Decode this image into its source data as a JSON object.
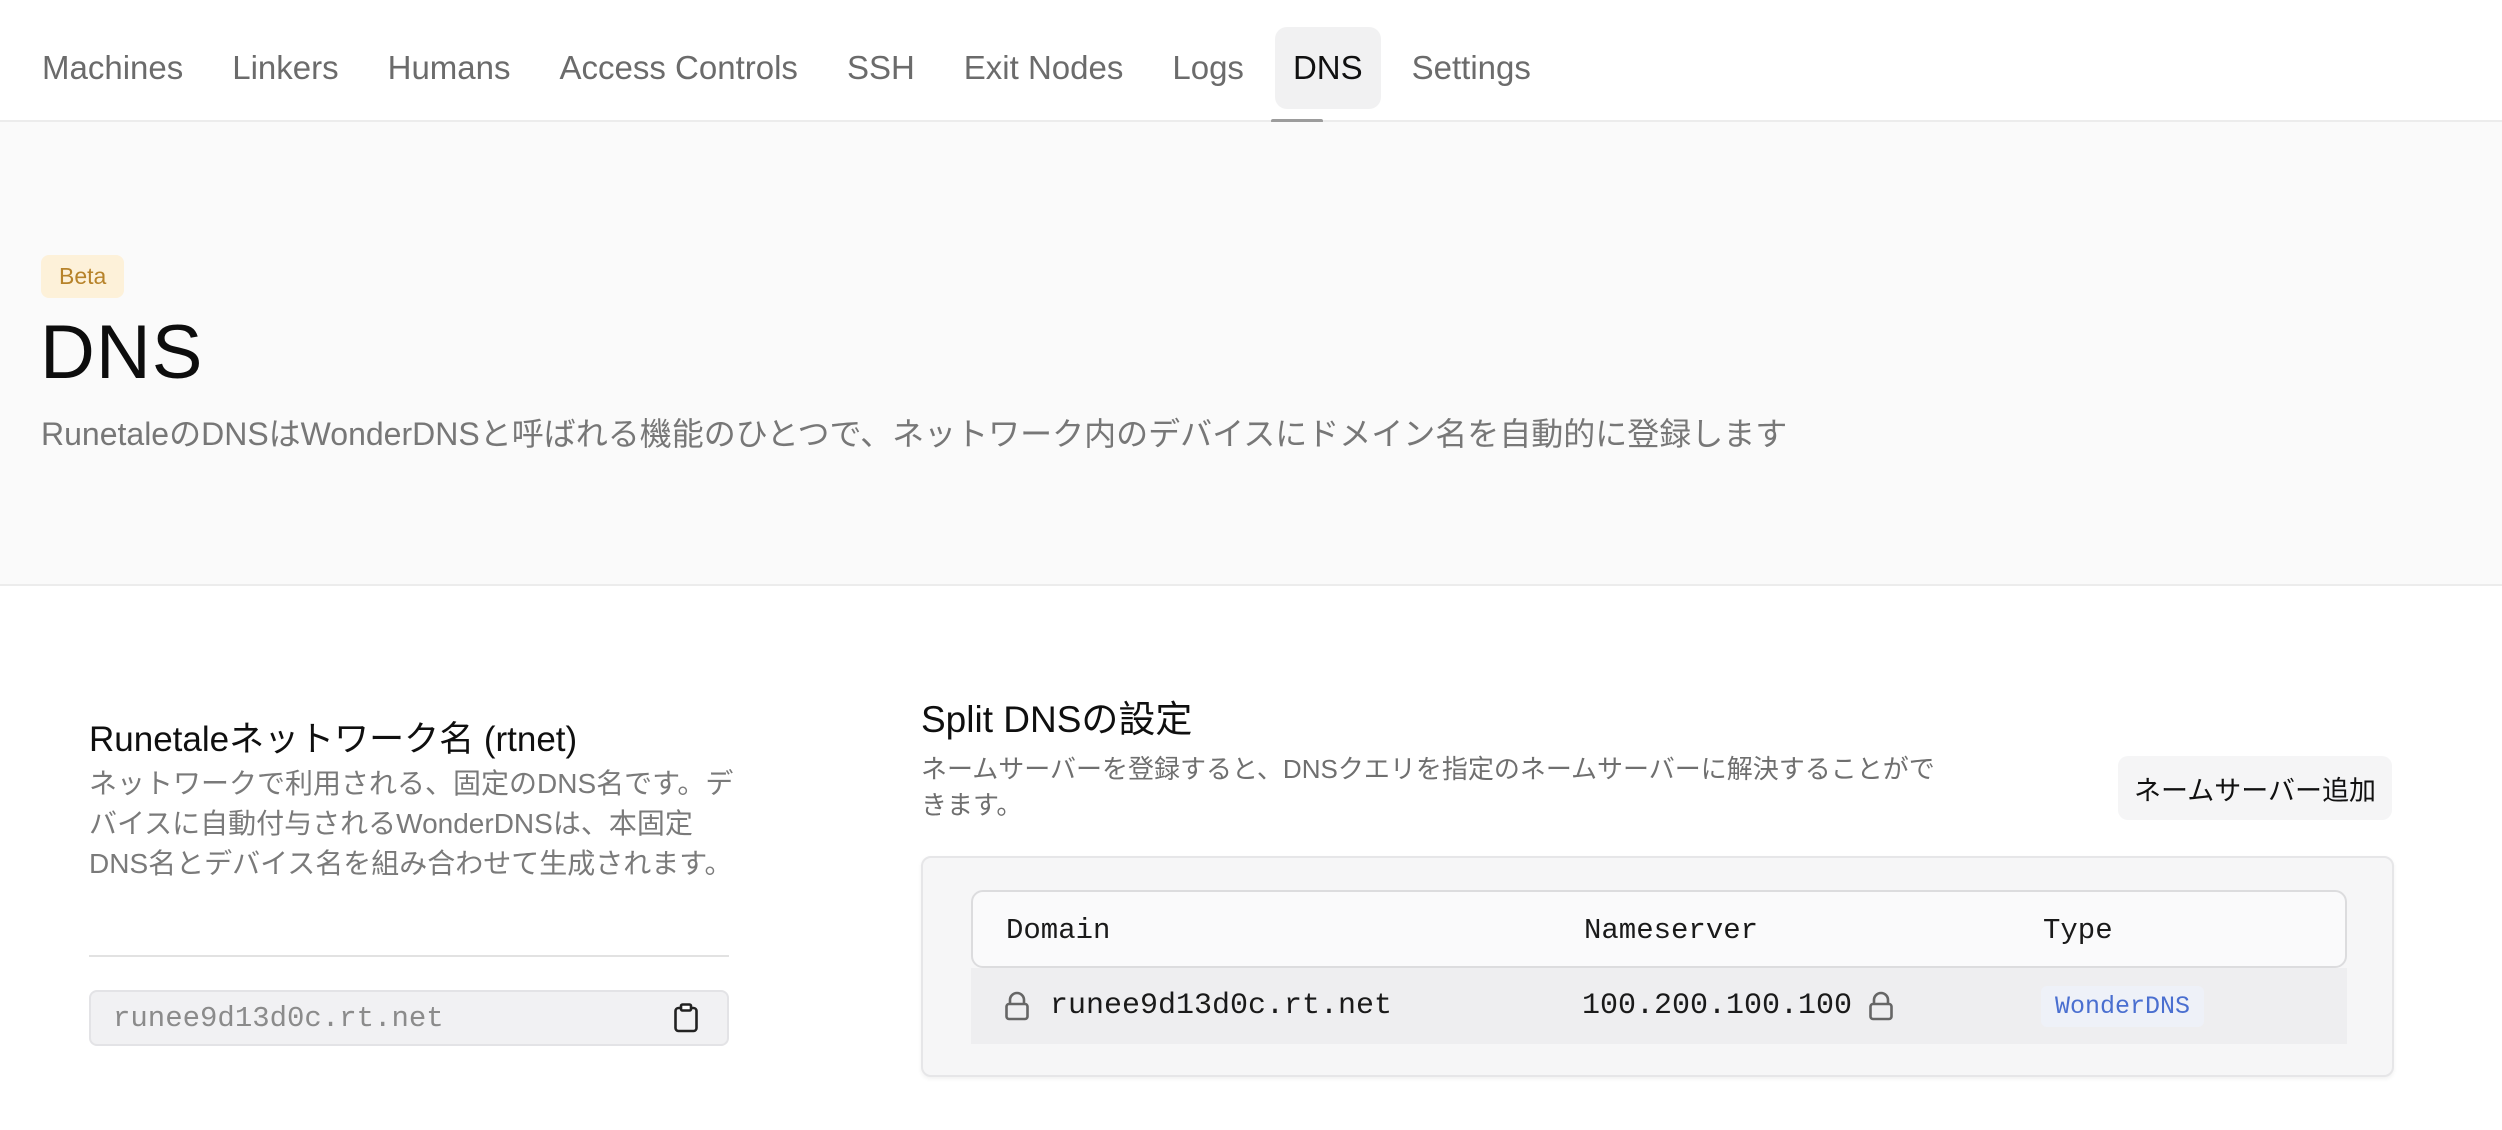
{
  "nav": {
    "tabs": [
      {
        "label": "Machines"
      },
      {
        "label": "Linkers"
      },
      {
        "label": "Humans"
      },
      {
        "label": "Access Controls"
      },
      {
        "label": "SSH"
      },
      {
        "label": "Exit Nodes"
      },
      {
        "label": "Logs"
      },
      {
        "label": "DNS",
        "active": true
      },
      {
        "label": "Settings"
      }
    ]
  },
  "hero": {
    "badge": "Beta",
    "title": "DNS",
    "description": "RunetaleのDNSはWonderDNSと呼ばれる機能のひとつで、ネットワーク内のデバイスにドメイン名を自動的に登録します"
  },
  "network": {
    "title": "Runetaleネットワーク名 (rtnet)",
    "description": "ネットワークで利用される、固定のDNS名です。デバイスに自動付与されるWonderDNSは、本固定DNS名とデバイス名を組み合わせて生成されます。",
    "value": "runee9d13d0c.rt.net",
    "copy_icon": "clipboard-icon"
  },
  "split_dns": {
    "title": "Split DNSの設定",
    "description": "ネームサーバーを登録すると、DNSクエリを指定のネームサーバーに解決することができます。",
    "add_button": "ネームサーバー追加",
    "columns": {
      "domain": "Domain",
      "nameserver": "Nameserver",
      "type": "Type"
    },
    "rows": [
      {
        "domain": "runee9d13d0c.rt.net",
        "nameserver": "100.200.100.100",
        "type": "WonderDNS",
        "locked": true
      }
    ]
  },
  "colors": {
    "beta_bg": "#fdf1d9",
    "beta_text": "#b7832a",
    "type_badge_text": "#4a6fd0"
  }
}
